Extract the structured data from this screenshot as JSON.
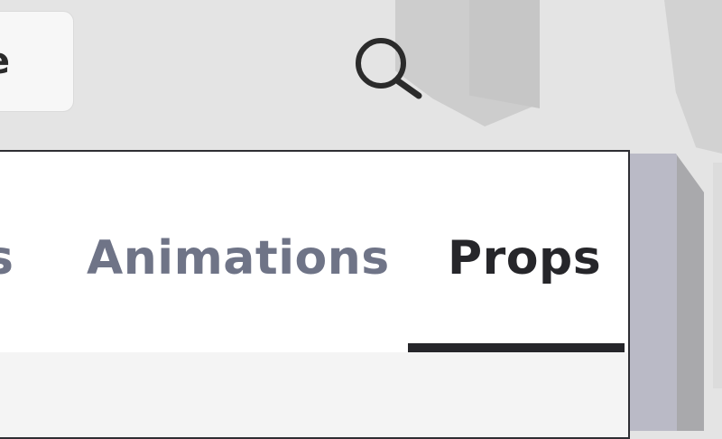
{
  "top_field": {
    "visible_text": "e"
  },
  "search": {
    "icon": "search-icon"
  },
  "tabs": [
    {
      "label": "s",
      "active": false
    },
    {
      "label": "Animations",
      "active": false
    },
    {
      "label": "Props",
      "active": true
    }
  ],
  "colors": {
    "active_tab_text": "#26262a",
    "inactive_tab_text": "#6f7487",
    "indicator": "#26262a",
    "panel_border": "#2e2e33",
    "panel_background": "#ffffff",
    "content_background": "#f4f4f4",
    "scrollbar": "#babac6"
  }
}
